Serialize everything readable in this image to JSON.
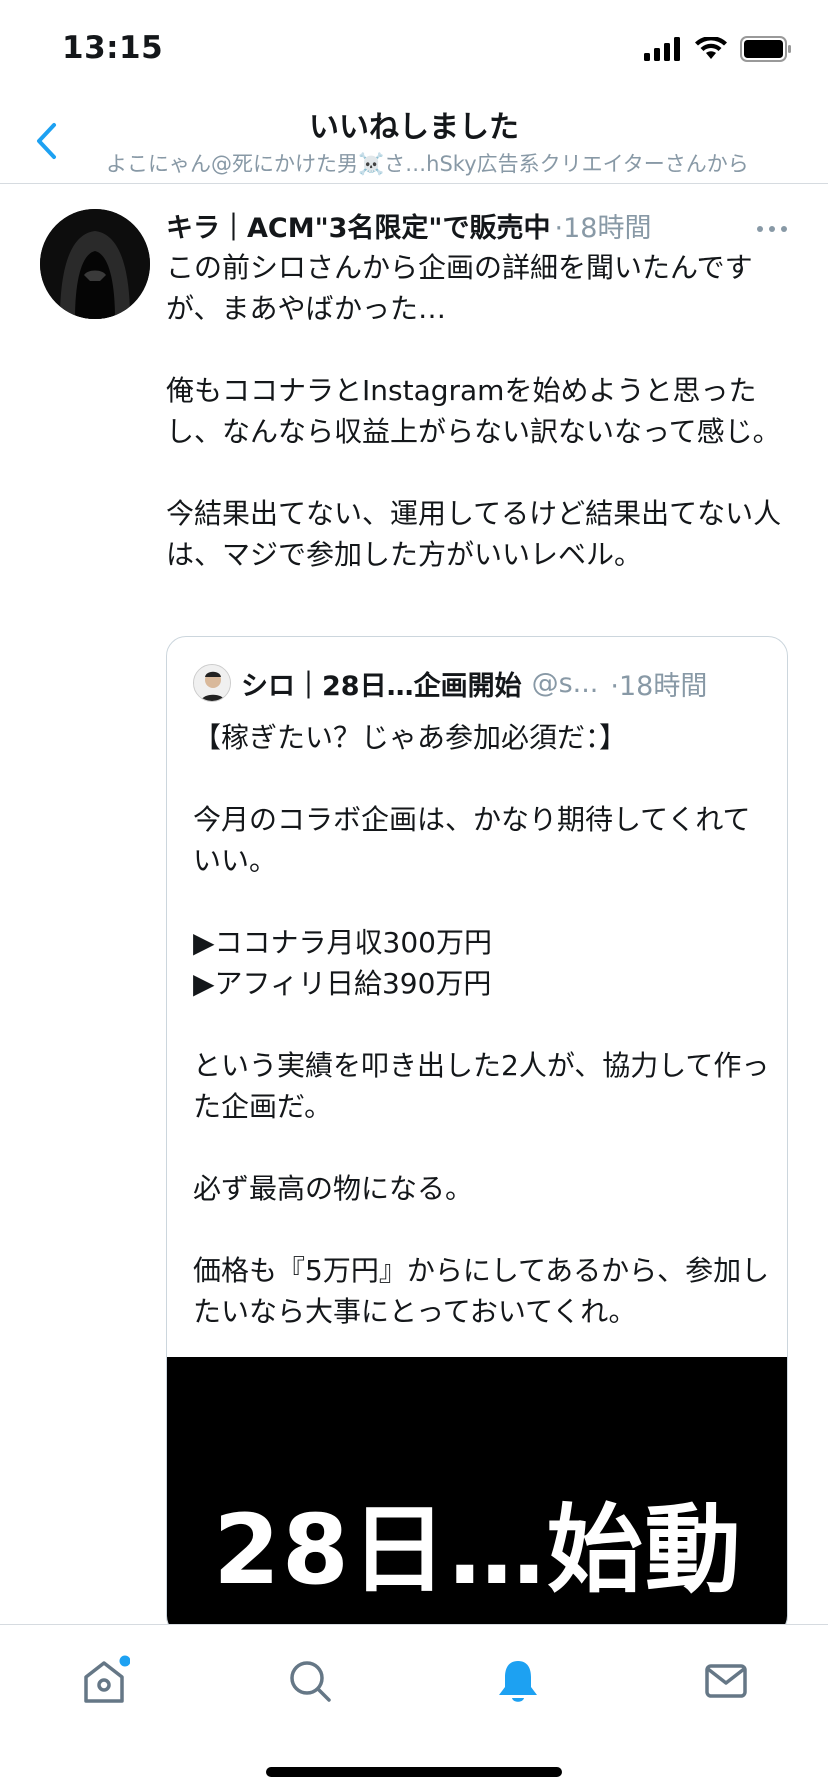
{
  "status_bar": {
    "time": "13:15",
    "icons": [
      "cellular-signal-icon",
      "wifi-icon",
      "battery-icon"
    ]
  },
  "header": {
    "title": "いいねしました",
    "subtitle": "よこにゃん@死にかけた男☠️さ…hSky広告系クリエイターさんから",
    "back_icon": "chevron-left-icon"
  },
  "tweet": {
    "author_name": "キラ｜ACM\"3名限定\"で販売中",
    "time": "·18時間",
    "text": "この前シロさんから企画の詳細を聞いたんですが、まあやばかった…\n\n俺もココナラとInstagramを始めようと思ったし、なんなら収益上がらない訳ないなって感じ。\n\n今結果出てない、運用してるけど結果出てない人は、マジで参加した方がいいレベル。",
    "more_icon": "more-horizontal-icon"
  },
  "quote": {
    "author_name": "シロ｜28日…企画開始",
    "handle": "@s...",
    "time": "·18時間",
    "text": "【稼ぎたい？じゃあ参加必須だ：】\n\n今月のコラボ企画は、かなり期待してくれていい。\n\n▶ココナラ月収300万円\n▶アフィリ日給390万円\n\nという実績を叩き出した2人が、協力して作った企画だ。\n\n必ず最高の物になる。\n\n価格も『5万円』からにしてあるから、参加したいなら大事にとっておいてくれ。",
    "media_text": "28日…始動"
  },
  "tab_bar": {
    "tabs": [
      {
        "name": "home",
        "icon": "home-icon",
        "has_badge": true
      },
      {
        "name": "search",
        "icon": "search-icon",
        "has_badge": false
      },
      {
        "name": "notifications",
        "icon": "bell-icon",
        "active": true
      },
      {
        "name": "messages",
        "icon": "mail-icon",
        "has_badge": false
      }
    ]
  },
  "colors": {
    "accent": "#1da1f2",
    "secondary_text": "#8899a6",
    "border": "#ccd6dd"
  }
}
